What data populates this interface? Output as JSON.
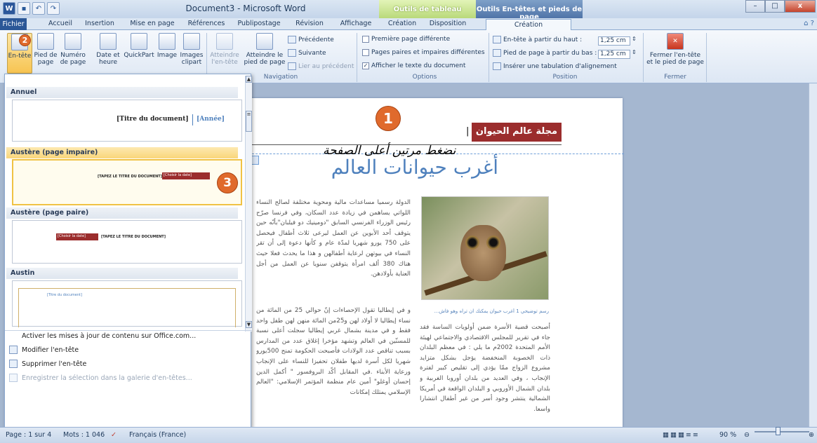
{
  "window": {
    "title": "Document3 - Microsoft Word",
    "context_tab_table": "Outils de tableau",
    "context_tab_header": "Outils En-têtes et pieds de page"
  },
  "qat": {
    "word_icon": "W",
    "save_icon": "save-icon",
    "undo_icon": "undo-icon",
    "redo_icon": "redo-icon"
  },
  "tabs": [
    "Fichier",
    "Accueil",
    "Insertion",
    "Mise en page",
    "Références",
    "Publipostage",
    "Révision",
    "Affichage",
    "Création",
    "Disposition",
    "Création"
  ],
  "ribbon": {
    "entete": "En-tête",
    "pied": "Pied de page",
    "numero": "Numéro de page",
    "date": "Date et heure",
    "quickpart": "QuickPart",
    "image": "Image",
    "images_clipart": "Images clipart",
    "atteindre_entete": "Atteindre l'en-tête",
    "atteindre_pied": "Atteindre le pied de page",
    "precedente": "Précédente",
    "suivante": "Suivante",
    "lier": "Lier au précédent",
    "grp_navigation": "Navigation",
    "opt1": "Première page différente",
    "opt2": "Pages paires et impaires différentes",
    "opt3": "Afficher le texte du document",
    "grp_options": "Options",
    "pos1": "En-tête à partir du haut :",
    "pos1_val": "1,25 cm",
    "pos2": "Pied de page à partir du bas :",
    "pos2_val": "1,25 cm",
    "pos3": "Insérer une tabulation d'alignement",
    "grp_position": "Position",
    "fermer": "Fermer l'en-tête et le pied de page",
    "grp_fermer": "Fermer"
  },
  "badges": {
    "b1": "1",
    "b2": "2",
    "b3": "3"
  },
  "panel": {
    "h1": "Annuel",
    "t1_title": "[Titre du document]",
    "t1_year": "[Année]",
    "h2": "Austère (page impaire)",
    "t2_title": "[TAPEZ LE TITRE DU DOCUMENT]",
    "t2_date": "[Choisir la date]",
    "h3": "Austère (page paire)",
    "t3_date": "[Choisir la date]",
    "t3_title": "[TAPEZ LE TITRE DU DOCUMENT]",
    "h4": "Austin",
    "t4_title": "[Titre du document]",
    "m1": "Activer les mises à jour de contenu sur Office.com...",
    "m2": "Modifier l'en-tête",
    "m3": "Supprimer l'en-tête",
    "m4": "Enregistrer la sélection dans la galerie d'en-têtes..."
  },
  "doc": {
    "header_label": "1-",
    "magazine": "مجلة عالم الحيوان",
    "instruction": "نضغط مرتين أعلى الصفحة",
    "title": "أغرب حيوانات العالم",
    "caption": "رسم توضيحي 1 أغرب حيوان يمكنك ان تراه وهو فاش...",
    "col_left_1": "الدولة رسميا مساعدات مالية ومحوية مختلفة لصالح النساء اللواتي يساهمن في زيادة عدد السكان، وفي فرنسا صرّح رئيس الوزراء الفرنسي السابق \"دومينيك دو فيلبان\"بأنّه حين يتوقف أحد الأبوين عن العمل ليرعى ثلاث أطفال فيحصل على 750 يورو شهريا لمدّة عام و كأنها دعوة إلى أن تقر النساء في بيوتهن لرعاية أطفالهن و هذا ما يحدث فعلا حيث هناك 380 ألف امرأة يتوقفن سنويا عن العمل من أجل العناية بأولادهن.",
    "col_left_2": "و في إيطاليا تقول الإحصاءات إنّ حوالي 25 من المائة من نساء إيطاليا لا أولاد لهن و25من المائة منهن لهن طفل واحد فقط و في مدينة بشمال غربي إيطاليا سجلت أعلى نسبة للمسنّين في العالم وتشهد مؤخرا إغلاق عدد من المدارس بسبب تناقص عدد الولادات فأصبحت الحكومة تمنح 500يورو شهريا لكل أسرة لديها طفلان تحفيزا للنساء على الإنجاب ورعاية الأبناء .في المقابل أكّد البروفسور \" أكمل الدين إحسان أوغلو\" أمين عام منظمة المؤتمر الإسلامي: \"العالم الإسلامي يمتلك إمكانات",
    "col_right": "أصبحت قضية الأسرة ضمن أولويات الساسة فقد جاء في تقرير للمجلس الاقتصادي والاجتماعي لهيئة الأمم المتحدة 2002م ما يلي : في معظم البلدان ذات الخصوبة المنخفضة يؤجل بشكل متزايد مشروع الزواج ممّا يؤدي إلى تقليص كبير لفترة الإنجاب ، وفي العديد من بلدان أوروبا الغربية و بلدان الشمال الأوروبي و البلدان الواقعة في أمريكا الشمالية ينتشر وجود أسر من غير أطفال انتشارا واسعا."
  },
  "status": {
    "page": "Page : 1 sur 4",
    "words": "Mots : 1 046",
    "lang": "Français (France)",
    "zoom": "90 %",
    "zoom_level": 0.6
  }
}
